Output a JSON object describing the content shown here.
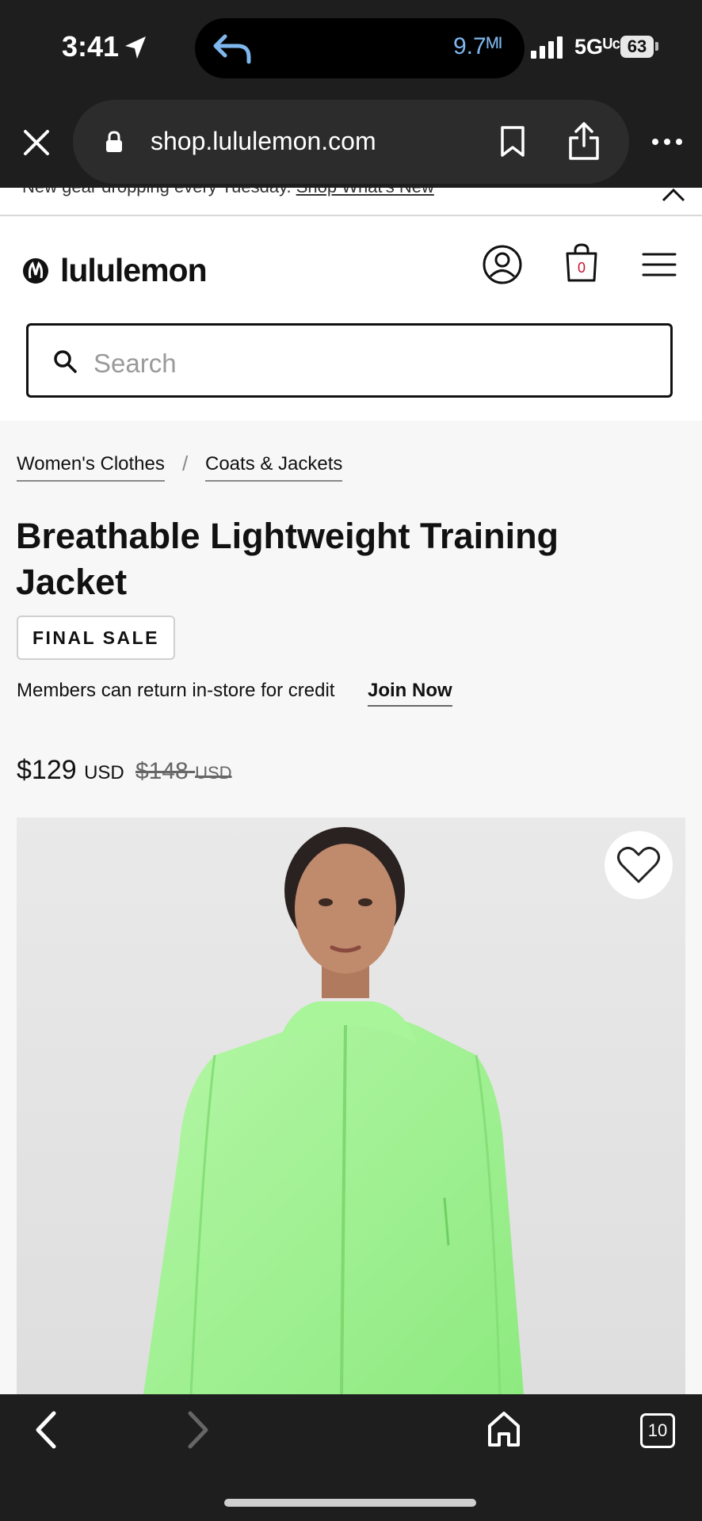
{
  "status": {
    "time": "3:41",
    "distance": "9.7ᴹᴵ",
    "network": "5Gᵁᶜ",
    "battery": "63"
  },
  "browser": {
    "url": "shop.lululemon.com",
    "tabs_count": "10"
  },
  "promo": {
    "text": "New gear dropping every Tuesday.",
    "link": "Shop What's New"
  },
  "header": {
    "brand": "lululemon",
    "bag_count": "0",
    "search_placeholder": "Search"
  },
  "breadcrumb": {
    "items": [
      "Women's Clothes",
      "Coats & Jackets"
    ],
    "separator": "/"
  },
  "product": {
    "title": "Breathable Lightweight Training Jacket",
    "badge": "FINAL SALE",
    "members_text": "Members can return in-store for credit",
    "join_label": "Join Now",
    "price": "$129",
    "price_currency": "USD",
    "original_price": "$148",
    "original_currency": "USD",
    "jacket_color": "#9ef08f"
  },
  "colors": {
    "brand_red": "#c8102e",
    "system_bar": "#1e1e1e",
    "island_text": "#7fb8ee"
  }
}
